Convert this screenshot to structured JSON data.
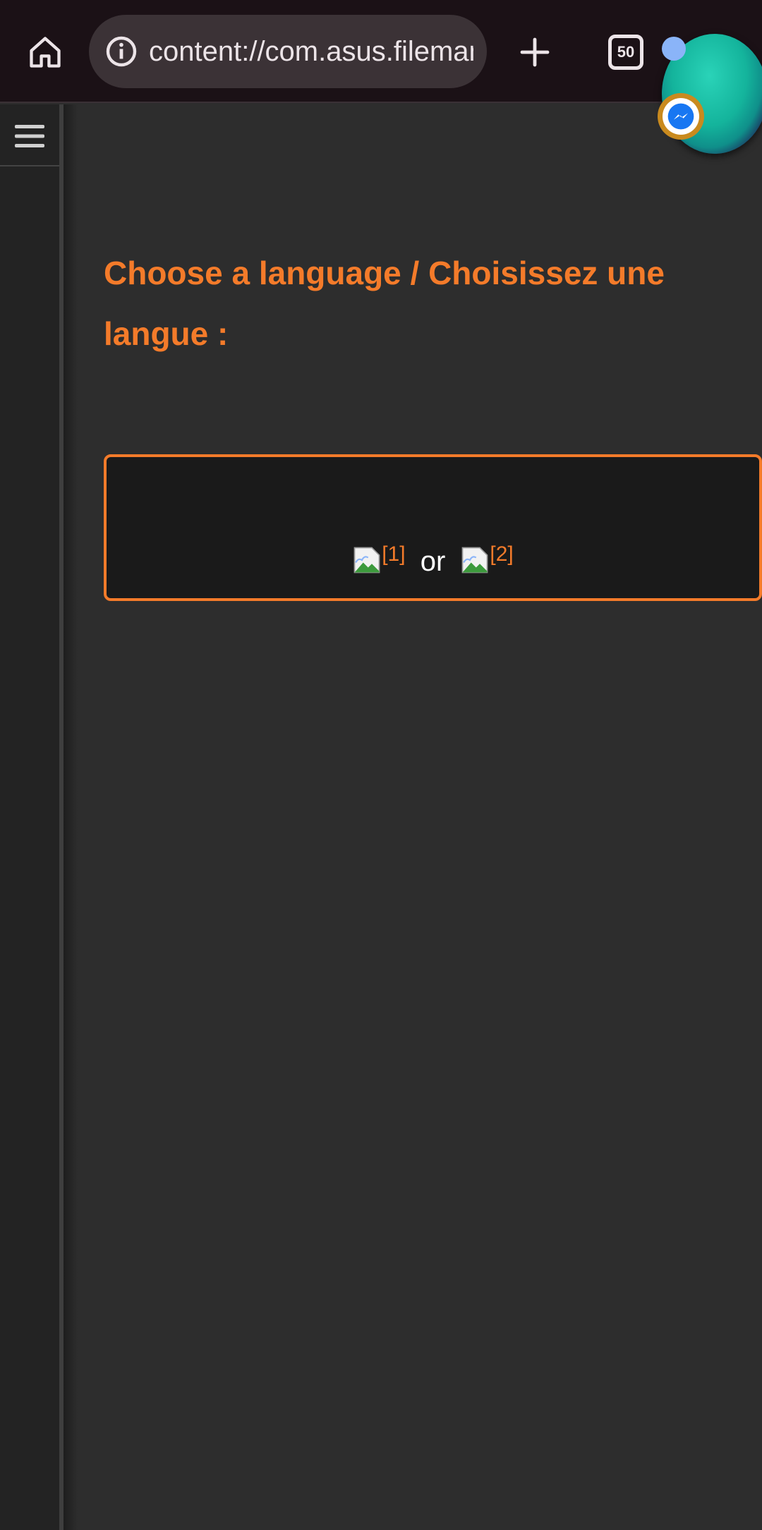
{
  "browser": {
    "url": "content://com.asus.filemanager",
    "tab_count": "50"
  },
  "page": {
    "heading": "Choose a language / Choisissez une langue :",
    "options": [
      {
        "ref": "[1]"
      },
      {
        "ref": "[2]"
      }
    ],
    "separator": "or"
  },
  "colors": {
    "accent": "#f47b2a",
    "toolbar_bg": "#1b1116",
    "page_bg": "#2d2d2d",
    "box_bg": "#1a1a1a"
  },
  "icons": {
    "home": "home-icon",
    "site_info": "info-icon",
    "new_tab": "plus-icon",
    "menu": "hamburger-menu-icon",
    "chat": "messenger-icon",
    "broken_image": "broken-image-icon"
  }
}
